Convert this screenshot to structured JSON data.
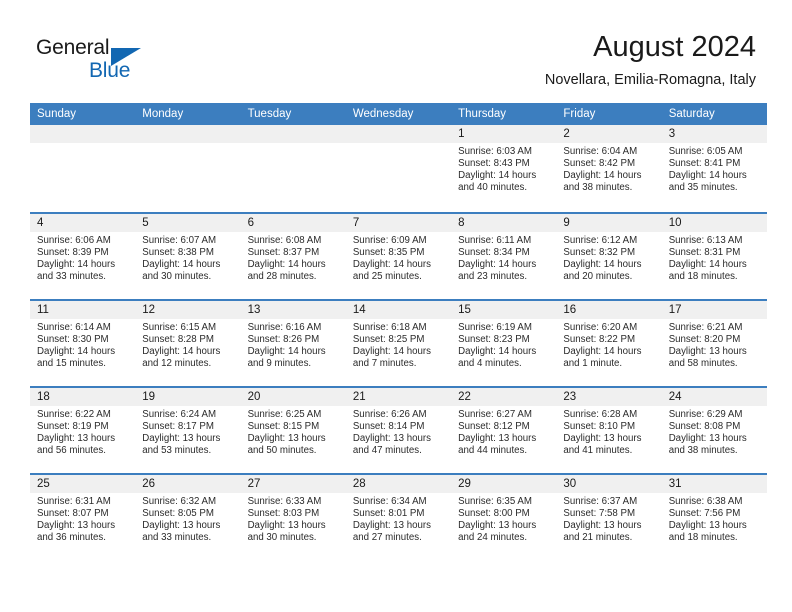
{
  "brand": {
    "word_one": "General",
    "word_two": "Blue",
    "logo_icon": "blue-triangle-logo",
    "accent_color": "#1267b2"
  },
  "header": {
    "title": "August 2024",
    "subtitle": "Novellara, Emilia-Romagna, Italy"
  },
  "calendar": {
    "header_bg": "#3c7ebf",
    "day_band_bg": "#f0f0f0",
    "weekdays": [
      "Sunday",
      "Monday",
      "Tuesday",
      "Wednesday",
      "Thursday",
      "Friday",
      "Saturday"
    ],
    "weeks": [
      [
        {
          "day": "",
          "empty": true,
          "sunrise": "",
          "sunset": "",
          "daylight_line1": "",
          "daylight_line2": ""
        },
        {
          "day": "",
          "empty": true,
          "sunrise": "",
          "sunset": "",
          "daylight_line1": "",
          "daylight_line2": ""
        },
        {
          "day": "",
          "empty": true,
          "sunrise": "",
          "sunset": "",
          "daylight_line1": "",
          "daylight_line2": ""
        },
        {
          "day": "",
          "empty": true,
          "sunrise": "",
          "sunset": "",
          "daylight_line1": "",
          "daylight_line2": ""
        },
        {
          "day": "1",
          "empty": false,
          "sunrise": "Sunrise: 6:03 AM",
          "sunset": "Sunset: 8:43 PM",
          "daylight_line1": "Daylight: 14 hours",
          "daylight_line2": "and 40 minutes."
        },
        {
          "day": "2",
          "empty": false,
          "sunrise": "Sunrise: 6:04 AM",
          "sunset": "Sunset: 8:42 PM",
          "daylight_line1": "Daylight: 14 hours",
          "daylight_line2": "and 38 minutes."
        },
        {
          "day": "3",
          "empty": false,
          "sunrise": "Sunrise: 6:05 AM",
          "sunset": "Sunset: 8:41 PM",
          "daylight_line1": "Daylight: 14 hours",
          "daylight_line2": "and 35 minutes."
        }
      ],
      [
        {
          "day": "4",
          "empty": false,
          "sunrise": "Sunrise: 6:06 AM",
          "sunset": "Sunset: 8:39 PM",
          "daylight_line1": "Daylight: 14 hours",
          "daylight_line2": "and 33 minutes."
        },
        {
          "day": "5",
          "empty": false,
          "sunrise": "Sunrise: 6:07 AM",
          "sunset": "Sunset: 8:38 PM",
          "daylight_line1": "Daylight: 14 hours",
          "daylight_line2": "and 30 minutes."
        },
        {
          "day": "6",
          "empty": false,
          "sunrise": "Sunrise: 6:08 AM",
          "sunset": "Sunset: 8:37 PM",
          "daylight_line1": "Daylight: 14 hours",
          "daylight_line2": "and 28 minutes."
        },
        {
          "day": "7",
          "empty": false,
          "sunrise": "Sunrise: 6:09 AM",
          "sunset": "Sunset: 8:35 PM",
          "daylight_line1": "Daylight: 14 hours",
          "daylight_line2": "and 25 minutes."
        },
        {
          "day": "8",
          "empty": false,
          "sunrise": "Sunrise: 6:11 AM",
          "sunset": "Sunset: 8:34 PM",
          "daylight_line1": "Daylight: 14 hours",
          "daylight_line2": "and 23 minutes."
        },
        {
          "day": "9",
          "empty": false,
          "sunrise": "Sunrise: 6:12 AM",
          "sunset": "Sunset: 8:32 PM",
          "daylight_line1": "Daylight: 14 hours",
          "daylight_line2": "and 20 minutes."
        },
        {
          "day": "10",
          "empty": false,
          "sunrise": "Sunrise: 6:13 AM",
          "sunset": "Sunset: 8:31 PM",
          "daylight_line1": "Daylight: 14 hours",
          "daylight_line2": "and 18 minutes."
        }
      ],
      [
        {
          "day": "11",
          "empty": false,
          "sunrise": "Sunrise: 6:14 AM",
          "sunset": "Sunset: 8:30 PM",
          "daylight_line1": "Daylight: 14 hours",
          "daylight_line2": "and 15 minutes."
        },
        {
          "day": "12",
          "empty": false,
          "sunrise": "Sunrise: 6:15 AM",
          "sunset": "Sunset: 8:28 PM",
          "daylight_line1": "Daylight: 14 hours",
          "daylight_line2": "and 12 minutes."
        },
        {
          "day": "13",
          "empty": false,
          "sunrise": "Sunrise: 6:16 AM",
          "sunset": "Sunset: 8:26 PM",
          "daylight_line1": "Daylight: 14 hours",
          "daylight_line2": "and 9 minutes."
        },
        {
          "day": "14",
          "empty": false,
          "sunrise": "Sunrise: 6:18 AM",
          "sunset": "Sunset: 8:25 PM",
          "daylight_line1": "Daylight: 14 hours",
          "daylight_line2": "and 7 minutes."
        },
        {
          "day": "15",
          "empty": false,
          "sunrise": "Sunrise: 6:19 AM",
          "sunset": "Sunset: 8:23 PM",
          "daylight_line1": "Daylight: 14 hours",
          "daylight_line2": "and 4 minutes."
        },
        {
          "day": "16",
          "empty": false,
          "sunrise": "Sunrise: 6:20 AM",
          "sunset": "Sunset: 8:22 PM",
          "daylight_line1": "Daylight: 14 hours",
          "daylight_line2": "and 1 minute."
        },
        {
          "day": "17",
          "empty": false,
          "sunrise": "Sunrise: 6:21 AM",
          "sunset": "Sunset: 8:20 PM",
          "daylight_line1": "Daylight: 13 hours",
          "daylight_line2": "and 58 minutes."
        }
      ],
      [
        {
          "day": "18",
          "empty": false,
          "sunrise": "Sunrise: 6:22 AM",
          "sunset": "Sunset: 8:19 PM",
          "daylight_line1": "Daylight: 13 hours",
          "daylight_line2": "and 56 minutes."
        },
        {
          "day": "19",
          "empty": false,
          "sunrise": "Sunrise: 6:24 AM",
          "sunset": "Sunset: 8:17 PM",
          "daylight_line1": "Daylight: 13 hours",
          "daylight_line2": "and 53 minutes."
        },
        {
          "day": "20",
          "empty": false,
          "sunrise": "Sunrise: 6:25 AM",
          "sunset": "Sunset: 8:15 PM",
          "daylight_line1": "Daylight: 13 hours",
          "daylight_line2": "and 50 minutes."
        },
        {
          "day": "21",
          "empty": false,
          "sunrise": "Sunrise: 6:26 AM",
          "sunset": "Sunset: 8:14 PM",
          "daylight_line1": "Daylight: 13 hours",
          "daylight_line2": "and 47 minutes."
        },
        {
          "day": "22",
          "empty": false,
          "sunrise": "Sunrise: 6:27 AM",
          "sunset": "Sunset: 8:12 PM",
          "daylight_line1": "Daylight: 13 hours",
          "daylight_line2": "and 44 minutes."
        },
        {
          "day": "23",
          "empty": false,
          "sunrise": "Sunrise: 6:28 AM",
          "sunset": "Sunset: 8:10 PM",
          "daylight_line1": "Daylight: 13 hours",
          "daylight_line2": "and 41 minutes."
        },
        {
          "day": "24",
          "empty": false,
          "sunrise": "Sunrise: 6:29 AM",
          "sunset": "Sunset: 8:08 PM",
          "daylight_line1": "Daylight: 13 hours",
          "daylight_line2": "and 38 minutes."
        }
      ],
      [
        {
          "day": "25",
          "empty": false,
          "sunrise": "Sunrise: 6:31 AM",
          "sunset": "Sunset: 8:07 PM",
          "daylight_line1": "Daylight: 13 hours",
          "daylight_line2": "and 36 minutes."
        },
        {
          "day": "26",
          "empty": false,
          "sunrise": "Sunrise: 6:32 AM",
          "sunset": "Sunset: 8:05 PM",
          "daylight_line1": "Daylight: 13 hours",
          "daylight_line2": "and 33 minutes."
        },
        {
          "day": "27",
          "empty": false,
          "sunrise": "Sunrise: 6:33 AM",
          "sunset": "Sunset: 8:03 PM",
          "daylight_line1": "Daylight: 13 hours",
          "daylight_line2": "and 30 minutes."
        },
        {
          "day": "28",
          "empty": false,
          "sunrise": "Sunrise: 6:34 AM",
          "sunset": "Sunset: 8:01 PM",
          "daylight_line1": "Daylight: 13 hours",
          "daylight_line2": "and 27 minutes."
        },
        {
          "day": "29",
          "empty": false,
          "sunrise": "Sunrise: 6:35 AM",
          "sunset": "Sunset: 8:00 PM",
          "daylight_line1": "Daylight: 13 hours",
          "daylight_line2": "and 24 minutes."
        },
        {
          "day": "30",
          "empty": false,
          "sunrise": "Sunrise: 6:37 AM",
          "sunset": "Sunset: 7:58 PM",
          "daylight_line1": "Daylight: 13 hours",
          "daylight_line2": "and 21 minutes."
        },
        {
          "day": "31",
          "empty": false,
          "sunrise": "Sunrise: 6:38 AM",
          "sunset": "Sunset: 7:56 PM",
          "daylight_line1": "Daylight: 13 hours",
          "daylight_line2": "and 18 minutes."
        }
      ]
    ]
  }
}
